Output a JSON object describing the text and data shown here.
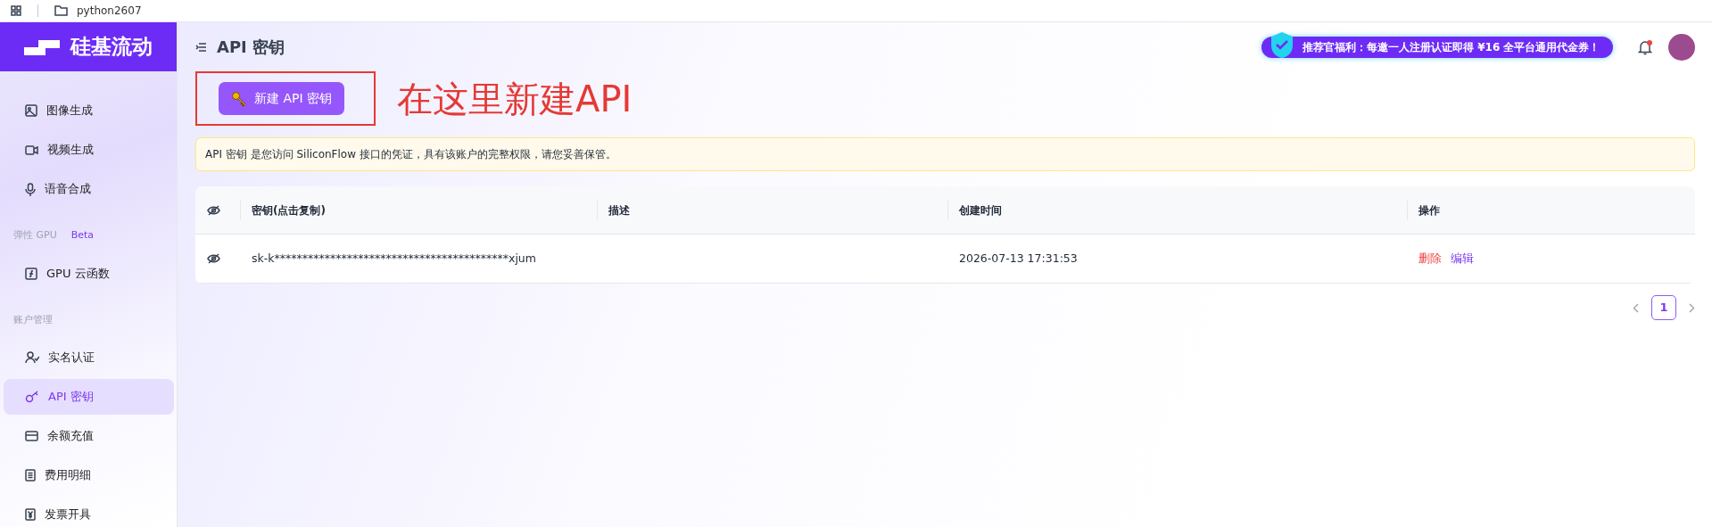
{
  "browser_bar": {
    "folder": "python2607"
  },
  "brand": {
    "name": "硅基流动"
  },
  "sidebar": {
    "items": [
      {
        "kind": "item",
        "label": "图像生成",
        "selected": false
      },
      {
        "kind": "item",
        "label": "视频生成",
        "selected": false
      },
      {
        "kind": "item",
        "label": "语音合成",
        "selected": false
      },
      {
        "kind": "heading",
        "label": "弹性 GPU",
        "badge": "Beta"
      },
      {
        "kind": "item",
        "label": "GPU 云函数",
        "selected": false
      },
      {
        "kind": "heading",
        "label": "账户管理"
      },
      {
        "kind": "item",
        "label": "实名认证",
        "selected": false
      },
      {
        "kind": "item",
        "label": "API 密钥",
        "selected": true
      },
      {
        "kind": "item",
        "label": "余额充值",
        "selected": false
      },
      {
        "kind": "item",
        "label": "费用明细",
        "selected": false
      },
      {
        "kind": "item",
        "label": "发票开具",
        "selected": false
      }
    ]
  },
  "header": {
    "title": "API 密钥",
    "promo": "推荐官福利：每邀一人注册认证即得 ¥16 全平台通用代金券！",
    "notification_unread": true
  },
  "create_button": {
    "label": "新建 API 密钥"
  },
  "annotation": {
    "text": "在这里新建API"
  },
  "alert": {
    "text": "API 密钥 是您访问 SiliconFlow 接口的凭证，具有该账户的完整权限，请您妥善保管。"
  },
  "table": {
    "columns": [
      {
        "kind": "icon"
      },
      {
        "kind": "text",
        "label": "密钥(点击复制)"
      },
      {
        "kind": "text",
        "label": "描述"
      },
      {
        "kind": "text",
        "label": "创建时间"
      },
      {
        "kind": "text",
        "label": "操作"
      }
    ],
    "rows": [
      {
        "key": "sk-k******************************************xjum",
        "created": "2026-07-13 17:31:53",
        "actions": [
          {
            "kind": "danger",
            "label": "删除"
          },
          {
            "kind": "link",
            "label": "编辑"
          }
        ]
      }
    ]
  },
  "pagination": {
    "pages": [
      {
        "label": "1",
        "selected": true
      }
    ]
  }
}
